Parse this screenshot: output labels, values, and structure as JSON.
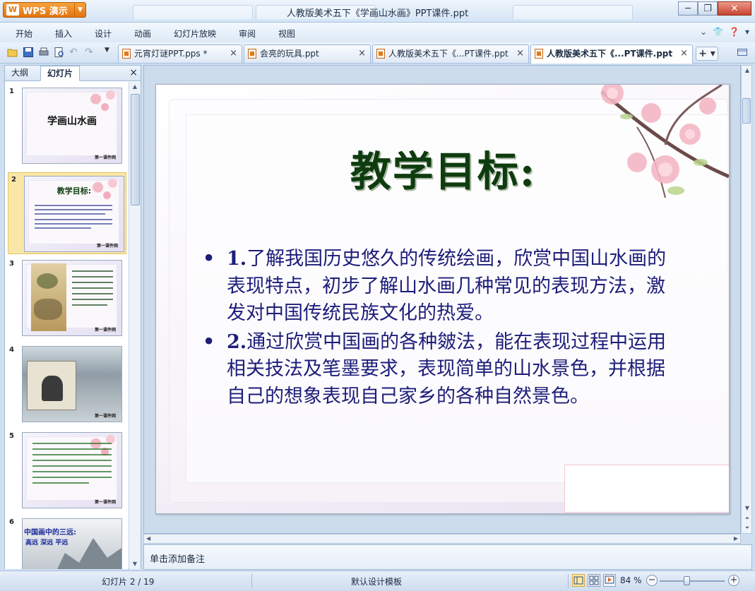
{
  "app": {
    "name": "WPS 演示",
    "window_title": "人教版美术五下《学画山水画》PPT课件.ppt"
  },
  "menu": [
    "开始",
    "插入",
    "设计",
    "动画",
    "幻灯片放映",
    "审阅",
    "视图"
  ],
  "doc_tabs": [
    {
      "label": "元宵灯谜PPT.pps *",
      "active": false
    },
    {
      "label": "会亮的玩具.ppt",
      "active": false
    },
    {
      "label": "人教版美术五下《...PT课件.ppt",
      "active": false
    },
    {
      "label": "人教版美术五下《...PT课件.ppt",
      "active": true
    }
  ],
  "panel": {
    "tabs": [
      "大纲",
      "幻灯片"
    ],
    "active_tab": "幻灯片"
  },
  "thumbnails": [
    {
      "num": "1",
      "title": "学画山水画",
      "brand": "第一课件网"
    },
    {
      "num": "2",
      "title": "教学目标:",
      "brand": "第一课件网",
      "selected": true
    },
    {
      "num": "3",
      "brand": "第一课件网"
    },
    {
      "num": "4",
      "brand": "第一课件网"
    },
    {
      "num": "5",
      "brand": "第一课件网"
    },
    {
      "num": "6",
      "title": "中国画中的三远:",
      "subtitle": "高远 深远 平远"
    }
  ],
  "slide": {
    "title": "教学目标:",
    "bullets": [
      {
        "num": "1.",
        "text": "了解我国历史悠久的传统绘画，欣赏中国山水画的表现特点，初步了解山水画几种常见的表现方法，激发对中国传统民族文化的热爱。"
      },
      {
        "num": "2.",
        "text": "通过欣赏中国画的各种皴法，能在表现过程中运用相关技法及笔墨要求，表现简单的山水景色，并根据自己的想象表现自己家乡的各种自然景色。"
      }
    ]
  },
  "notes": {
    "placeholder": "单击添加备注"
  },
  "status": {
    "slide_position": "幻灯片 2 / 19",
    "template": "默认设计模板",
    "zoom": "84 %"
  },
  "colors": {
    "title_green": "#0f3c0f",
    "body_navy": "#1d1d7a",
    "accent_orange": "#e2740e"
  }
}
